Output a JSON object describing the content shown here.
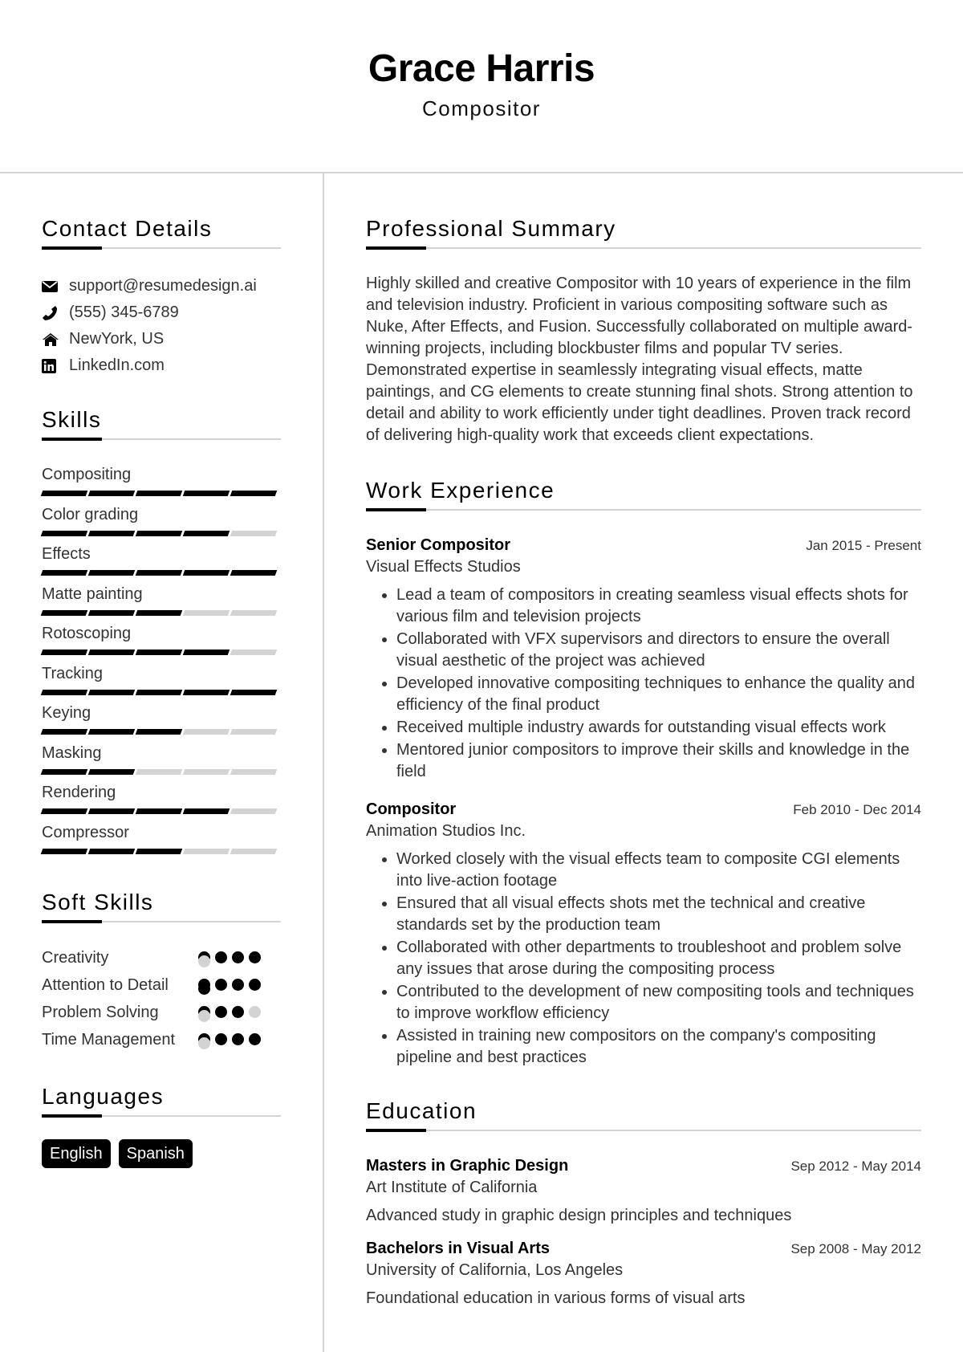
{
  "header": {
    "name": "Grace Harris",
    "title": "Compositor"
  },
  "contact": {
    "heading": "Contact Details",
    "items": [
      {
        "icon": "envelope-icon",
        "text": "support@resumedesign.ai"
      },
      {
        "icon": "phone-icon",
        "text": "(555) 345-6789"
      },
      {
        "icon": "home-icon",
        "text": "NewYork, US"
      },
      {
        "icon": "linkedin-icon",
        "text": "LinkedIn.com"
      }
    ]
  },
  "skills": {
    "heading": "Skills",
    "max": 5,
    "items": [
      {
        "label": "Compositing",
        "level": 5
      },
      {
        "label": "Color grading",
        "level": 4
      },
      {
        "label": "Effects",
        "level": 5
      },
      {
        "label": "Matte painting",
        "level": 3
      },
      {
        "label": "Rotoscoping",
        "level": 4
      },
      {
        "label": "Tracking",
        "level": 5
      },
      {
        "label": "Keying",
        "level": 3
      },
      {
        "label": "Masking",
        "level": 2
      },
      {
        "label": "Rendering",
        "level": 4
      },
      {
        "label": "Compressor",
        "level": 3
      }
    ]
  },
  "soft_skills": {
    "heading": "Soft Skills",
    "max": 5,
    "items": [
      {
        "label": "Creativity",
        "level": 4
      },
      {
        "label": "Attention to Detail",
        "level": 5
      },
      {
        "label": "Problem Solving",
        "level": 3
      },
      {
        "label": "Time Management",
        "level": 4
      }
    ]
  },
  "languages": {
    "heading": "Languages",
    "items": [
      "English",
      "Spanish"
    ]
  },
  "summary": {
    "heading": "Professional Summary",
    "text": "Highly skilled and creative Compositor with 10 years of experience in the film and television industry. Proficient in various compositing software such as Nuke, After Effects, and Fusion. Successfully collaborated on multiple award-winning projects, including blockbuster films and popular TV series. Demonstrated expertise in seamlessly integrating visual effects, matte paintings, and CG elements to create stunning final shots. Strong attention to detail and ability to work efficiently under tight deadlines. Proven track record of delivering high-quality work that exceeds client expectations."
  },
  "experience": {
    "heading": "Work Experience",
    "jobs": [
      {
        "title": "Senior Compositor",
        "company": "Visual Effects Studios",
        "date": "Jan 2015 - Present",
        "bullets": [
          "Lead a team of compositors in creating seamless visual effects shots for various film and television projects",
          "Collaborated with VFX supervisors and directors to ensure the overall visual aesthetic of the project was achieved",
          "Developed innovative compositing techniques to enhance the quality and efficiency of the final product",
          "Received multiple industry awards for outstanding visual effects work",
          "Mentored junior compositors to improve their skills and knowledge in the field"
        ]
      },
      {
        "title": "Compositor",
        "company": "Animation Studios Inc.",
        "date": "Feb 2010 - Dec 2014",
        "bullets": [
          "Worked closely with the visual effects team to composite CGI elements into live-action footage",
          "Ensured that all visual effects shots met the technical and creative standards set by the production team",
          "Collaborated with other departments to troubleshoot and problem solve any issues that arose during the compositing process",
          "Contributed to the development of new compositing tools and techniques to improve workflow efficiency",
          "Assisted in training new compositors on the company's compositing pipeline and best practices"
        ]
      }
    ]
  },
  "education": {
    "heading": "Education",
    "items": [
      {
        "degree": "Masters in Graphic Design",
        "school": "Art Institute of California",
        "date": "Sep 2012 - May 2014",
        "description": "Advanced study in graphic design principles and techniques"
      },
      {
        "degree": "Bachelors in Visual Arts",
        "school": "University of California, Los Angeles",
        "date": "Sep 2008 - May 2012",
        "description": "Foundational education in various forms of visual arts"
      }
    ]
  }
}
